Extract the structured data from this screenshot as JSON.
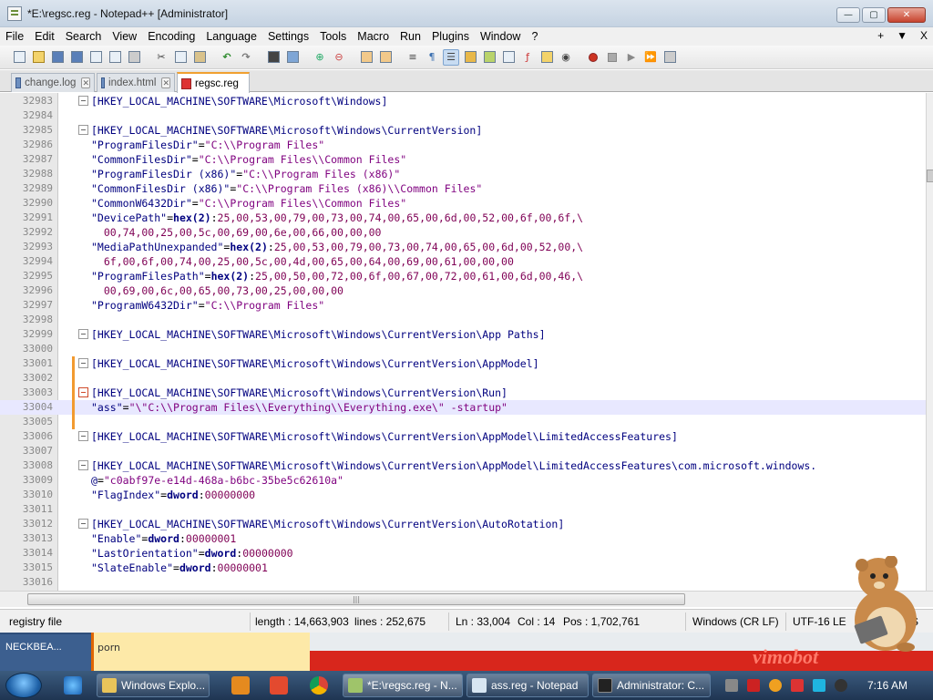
{
  "window": {
    "title": "*E:\\regsc.reg - Notepad++ [Administrator]"
  },
  "window_controls": {
    "minimize": "—",
    "maximize": "▢",
    "close": "✕"
  },
  "menu": {
    "items": [
      "File",
      "Edit",
      "Search",
      "View",
      "Encoding",
      "Language",
      "Settings",
      "Tools",
      "Macro",
      "Run",
      "Plugins",
      "Window",
      "?"
    ],
    "right": [
      "+",
      "▼",
      "X"
    ]
  },
  "tabs": [
    {
      "label": "change.log",
      "active": false
    },
    {
      "label": "index.html",
      "active": false
    },
    {
      "label": "regsc.reg",
      "active": true
    }
  ],
  "tab_close": "✕",
  "editor": {
    "lines": [
      {
        "n": "32983",
        "t": "[HKEY_LOCAL_MACHINE\\SOFTWARE\\Microsoft\\Windows]"
      },
      {
        "n": "32984",
        "t": ""
      },
      {
        "n": "32985",
        "t": "[HKEY_LOCAL_MACHINE\\SOFTWARE\\Microsoft\\Windows\\CurrentVersion]"
      },
      {
        "n": "32986",
        "t": "\"ProgramFilesDir\"=\"C:\\\\Program Files\""
      },
      {
        "n": "32987",
        "t": "\"CommonFilesDir\"=\"C:\\\\Program Files\\\\Common Files\""
      },
      {
        "n": "32988",
        "t": "\"ProgramFilesDir (x86)\"=\"C:\\\\Program Files (x86)\""
      },
      {
        "n": "32989",
        "t": "\"CommonFilesDir (x86)\"=\"C:\\\\Program Files (x86)\\\\Common Files\""
      },
      {
        "n": "32990",
        "t": "\"CommonW6432Dir\"=\"C:\\\\Program Files\\\\Common Files\""
      },
      {
        "n": "32991",
        "t": "\"DevicePath\"=hex(2):25,00,53,00,79,00,73,00,74,00,65,00,6d,00,52,00,6f,00,6f,\\"
      },
      {
        "n": "32992",
        "t": "  00,74,00,25,00,5c,00,69,00,6e,00,66,00,00,00"
      },
      {
        "n": "32993",
        "t": "\"MediaPathUnexpanded\"=hex(2):25,00,53,00,79,00,73,00,74,00,65,00,6d,00,52,00,\\"
      },
      {
        "n": "32994",
        "t": "  6f,00,6f,00,74,00,25,00,5c,00,4d,00,65,00,64,00,69,00,61,00,00,00"
      },
      {
        "n": "32995",
        "t": "\"ProgramFilesPath\"=hex(2):25,00,50,00,72,00,6f,00,67,00,72,00,61,00,6d,00,46,\\"
      },
      {
        "n": "32996",
        "t": "  00,69,00,6c,00,65,00,73,00,25,00,00,00"
      },
      {
        "n": "32997",
        "t": "\"ProgramW6432Dir\"=\"C:\\\\Program Files\""
      },
      {
        "n": "32998",
        "t": ""
      },
      {
        "n": "32999",
        "t": "[HKEY_LOCAL_MACHINE\\SOFTWARE\\Microsoft\\Windows\\CurrentVersion\\App Paths]"
      },
      {
        "n": "33000",
        "t": ""
      },
      {
        "n": "33001",
        "t": "[HKEY_LOCAL_MACHINE\\SOFTWARE\\Microsoft\\Windows\\CurrentVersion\\AppModel]"
      },
      {
        "n": "33002",
        "t": ""
      },
      {
        "n": "33003",
        "t": "[HKEY_LOCAL_MACHINE\\SOFTWARE\\Microsoft\\Windows\\CurrentVersion\\Run]"
      },
      {
        "n": "33004",
        "t": "\"ass\"=\"\\\"C:\\\\Program Files\\\\Everything\\\\Everything.exe\\\" -startup\""
      },
      {
        "n": "33005",
        "t": ""
      },
      {
        "n": "33006",
        "t": "[HKEY_LOCAL_MACHINE\\SOFTWARE\\Microsoft\\Windows\\CurrentVersion\\AppModel\\LimitedAccessFeatures]"
      },
      {
        "n": "33007",
        "t": ""
      },
      {
        "n": "33008",
        "t": "[HKEY_LOCAL_MACHINE\\SOFTWARE\\Microsoft\\Windows\\CurrentVersion\\AppModel\\LimitedAccessFeatures\\com.microsoft.windows."
      },
      {
        "n": "33009",
        "t": "@=\"c0abf97e-e14d-468a-b6bc-35be5c62610a\""
      },
      {
        "n": "33010",
        "t": "\"FlagIndex\"=dword:00000000"
      },
      {
        "n": "33011",
        "t": ""
      },
      {
        "n": "33012",
        "t": "[HKEY_LOCAL_MACHINE\\SOFTWARE\\Microsoft\\Windows\\CurrentVersion\\AutoRotation]"
      },
      {
        "n": "33013",
        "t": "\"Enable\"=dword:00000001"
      },
      {
        "n": "33014",
        "t": "\"LastOrientation\"=dword:00000000"
      },
      {
        "n": "33015",
        "t": "\"SlateEnable\"=dword:00000001"
      },
      {
        "n": "33016",
        "t": ""
      }
    ]
  },
  "hscroll": {
    "grip": "|||"
  },
  "status": {
    "filetype": "registry file",
    "length": "length : 14,663,903",
    "lines": "lines : 252,675",
    "ln": "Ln : 33,004",
    "col": "Col : 14",
    "pos": "Pos : 1,702,761",
    "eol": "Windows (CR LF)",
    "encoding": "UTF-16 LE",
    "ins": "S"
  },
  "desktop": {
    "label1": "NECKBEA...",
    "label2": "porn",
    "logo": "vimobot"
  },
  "taskbar": {
    "buttons": [
      {
        "label": "Windows Explo...",
        "color": "#e8c45a"
      },
      {
        "label": "*E:\\regsc.reg - N...",
        "color": "#9fc46a"
      },
      {
        "label": "ass.reg - Notepad",
        "color": "#d8e6f2"
      },
      {
        "label": "Administrator: C...",
        "color": "#222222"
      }
    ],
    "clock": "7:16 AM"
  },
  "colors": {
    "accent_tab": "#f0a030",
    "current_line": "#e8e8ff",
    "change_marker": "#f29a30"
  }
}
